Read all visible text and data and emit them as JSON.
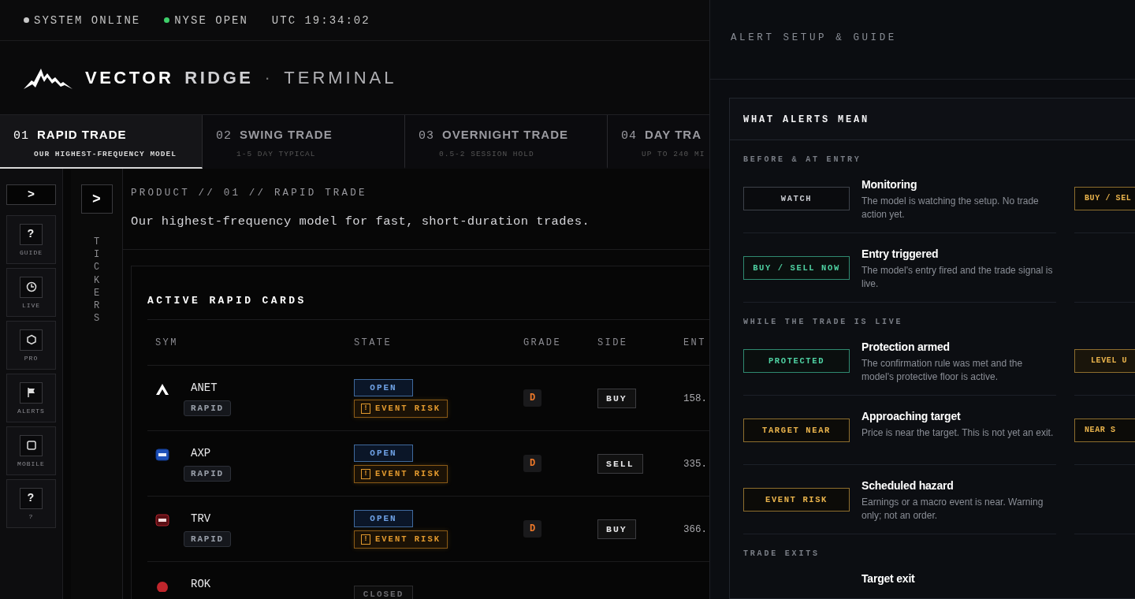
{
  "status_bar": {
    "items": [
      {
        "label": "SYSTEM ONLINE",
        "color": "#c8c8c8"
      },
      {
        "label": "NYSE OPEN",
        "color": "#3ecf6a"
      }
    ],
    "time": "UTC 19:34:02"
  },
  "brand": {
    "name_1": "VECTOR",
    "name_2": "RIDGE",
    "separator": "·",
    "product": "TERMINAL"
  },
  "tabs": [
    {
      "num": "01",
      "title": "RAPID TRADE",
      "subtitle": "OUR HIGHEST-FREQUENCY MODEL",
      "selected": true
    },
    {
      "num": "02",
      "title": "SWING TRADE",
      "subtitle": "1-5 DAY TYPICAL",
      "selected": false
    },
    {
      "num": "03",
      "title": "OVERNIGHT TRADE",
      "subtitle": "0.5-2 SESSION HOLD",
      "selected": false
    },
    {
      "num": "04",
      "title": "DAY TRA",
      "subtitle": "UP TO 240 MI",
      "selected": false
    }
  ],
  "rail": {
    "toggle": ">",
    "items": [
      {
        "kind": "help",
        "glyph": "?",
        "label": "GUIDE"
      },
      {
        "kind": "clock",
        "label": "LIVE"
      },
      {
        "kind": "hexagon",
        "label": "PRO"
      },
      {
        "kind": "flag",
        "label": "ALERTS"
      },
      {
        "kind": "square",
        "label": "MOBILE"
      },
      {
        "kind": "help",
        "glyph": "?",
        "label": "?"
      }
    ]
  },
  "tickers_panel": {
    "toggle": ">",
    "label": "TICKERS"
  },
  "product": {
    "breadcrumb": "PRODUCT // 01 // RAPID TRADE",
    "description": "Our highest-frequency model for fast, short-duration trades."
  },
  "cards": {
    "title": "ACTIVE RAPID CARDS",
    "columns": [
      "SYM",
      "STATE",
      "GRADE",
      "SIDE",
      "ENT"
    ],
    "rows": [
      {
        "sym": "ANET",
        "logo": {
          "kind": "chevron"
        },
        "tag": "RAPID",
        "state": {
          "label": "OPEN",
          "kind": "open"
        },
        "event_risk": {
          "icon": "!",
          "label": "EVENT RISK"
        },
        "grade": "D",
        "side": "BUY",
        "entry": "158."
      },
      {
        "sym": "AXP",
        "logo": {
          "kind": "blue"
        },
        "tag": "RAPID",
        "state": {
          "label": "OPEN",
          "kind": "open"
        },
        "event_risk": {
          "icon": "!",
          "label": "EVENT RISK"
        },
        "grade": "D",
        "side": "SELL",
        "entry": "335."
      },
      {
        "sym": "TRV",
        "logo": {
          "kind": "red"
        },
        "tag": "RAPID",
        "state": {
          "label": "OPEN",
          "kind": "open"
        },
        "event_risk": {
          "icon": "!",
          "label": "EVENT RISK"
        },
        "grade": "D",
        "side": "BUY",
        "entry": "366."
      },
      {
        "sym": "ROK",
        "logo": {
          "kind": "dot"
        },
        "state": {
          "label": "CLOSED",
          "kind": "closed"
        }
      }
    ]
  },
  "drawer": {
    "title": "ALERT SETUP & GUIDE",
    "card_title": "WHAT ALERTS MEAN",
    "sections": [
      {
        "heading": "BEFORE & AT ENTRY",
        "items": [
          {
            "badge": {
              "label": "WATCH",
              "kind": "neutral"
            },
            "title": "Monitoring",
            "description": "The model is watching the setup. No trade action yet.",
            "side": {
              "label": "BUY / SEL",
              "kind": "amber"
            }
          },
          {
            "badge": {
              "label": "BUY / SELL NOW",
              "kind": "green"
            },
            "title": "Entry triggered",
            "description": "The model's entry fired and the trade signal is live."
          }
        ]
      },
      {
        "heading": "WHILE THE TRADE IS LIVE",
        "items": [
          {
            "badge": {
              "label": "PROTECTED",
              "kind": "green"
            },
            "title": "Protection armed",
            "description": "The confirmation rule was met and the model's protective floor is active.",
            "side": {
              "label": "LEVEL U",
              "kind": "amber-fill"
            }
          },
          {
            "badge": {
              "label": "TARGET NEAR",
              "kind": "amber"
            },
            "title": "Approaching target",
            "description": "Price is near the target. This is not yet an exit.",
            "side": {
              "label": "NEAR S",
              "kind": "amber"
            }
          },
          {
            "badge": {
              "label": "EVENT RISK",
              "kind": "amber"
            },
            "title": "Scheduled hazard",
            "description": "Earnings or a macro event is near. Warning only; not an order."
          }
        ]
      },
      {
        "heading": "TRADE EXITS",
        "items": [
          {
            "title": "Target exit"
          }
        ]
      }
    ]
  }
}
